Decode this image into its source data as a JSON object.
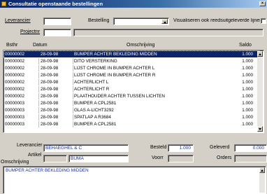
{
  "window": {
    "title": "Consultatie openstaande bestellingen",
    "close_glyph": "×"
  },
  "filters": {
    "leverancier_label": "Leverancier",
    "leverancier_value": "",
    "projectnr_label": "Projectnr",
    "projectnr_value": "",
    "bestelling_label": "Bestelling",
    "bestelling_value": "",
    "visualiseren_label": "Visualiseren ook reedsuitgeleverde lijnen"
  },
  "grid": {
    "headers": {
      "bsthr": "Bsthr",
      "datum": "Datum",
      "omschrijving": "Omschrijving",
      "saldo": "Saldo"
    },
    "rows": [
      {
        "bsthr": "00000002",
        "datum": "28-09-98",
        "omschrijving": "BUMPER ACHTER BEKLEDING MIDDEN",
        "saldo": "1.000",
        "selected": true
      },
      {
        "bsthr": "00000002",
        "datum": "28-09-98",
        "omschrijving": "DITO VERSTERKING",
        "saldo": "1.000"
      },
      {
        "bsthr": "00000002",
        "datum": "28-09-98",
        "omschrijving": "LIJST CHROME IN BUMPER ACHTER L",
        "saldo": "1.000"
      },
      {
        "bsthr": "00000002",
        "datum": "28-09-98",
        "omschrijving": "LIJST CHROME IN BUMPER ACHTER R",
        "saldo": "1.000"
      },
      {
        "bsthr": "00000002",
        "datum": "28-09-98",
        "omschrijving": "ACHTERLICHT L",
        "saldo": "1.000"
      },
      {
        "bsthr": "00000002",
        "datum": "28-09-98",
        "omschrijving": "ACHTERLICHT R",
        "saldo": "1.000"
      },
      {
        "bsthr": "00000002",
        "datum": "28-09-98",
        "omschrijving": "PLAATHOUDER ACHTER TUSSEN LICHTEN",
        "saldo": "1.000"
      },
      {
        "bsthr": "00000003",
        "datum": "28-09-98",
        "omschrijving": "BUMPER A CPL2581",
        "saldo": "1.000"
      },
      {
        "bsthr": "00000003",
        "datum": "28-09-98",
        "omschrijving": "GLAS A-LICHT3292",
        "saldo": "1.000"
      },
      {
        "bsthr": "00000003",
        "datum": "28-09-98",
        "omschrijving": "SPATLAP A R3684",
        "saldo": "1.000"
      },
      {
        "bsthr": "00000003",
        "datum": "28-09-98",
        "omschrijving": "BUMPER A CPL2581",
        "saldo": "1.000"
      }
    ]
  },
  "detail": {
    "leverancier_label": "Leverancier",
    "leverancier_value": "BEHAEGHEL & C",
    "artikel_label": "Artikel",
    "artikel_code": "",
    "artikel_value": "BUMA",
    "omschrijving_label": "Omschrijving",
    "besteld_label": "Besteld",
    "besteld_value": "1.000",
    "geleverd_label": "Geleverd",
    "geleverd_value": "0.000",
    "voorr_label": "Voorr",
    "voorr_value": "",
    "orders_label": "Orders",
    "orders_value": "",
    "memo_text": "BUMPER ACHTER BEKLEDING MIDDEN"
  },
  "colors": {
    "titlebar": "#0a246a",
    "selection": "#0a246a",
    "value_text": "#1a2f9a",
    "face": "#d4d0c8"
  }
}
